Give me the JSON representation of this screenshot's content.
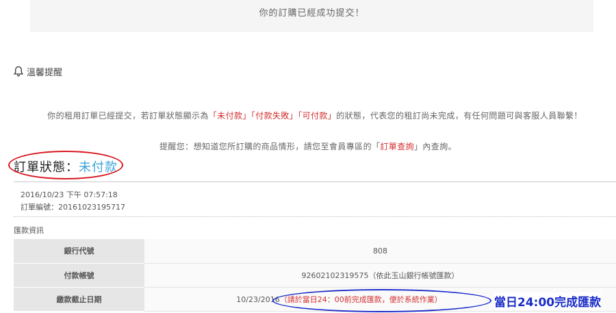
{
  "banner": {
    "message": "你的訂購已經成功提交！"
  },
  "reminder": {
    "title": "溫馨提醒",
    "icon": "bell-icon",
    "line1": {
      "prefix": "你的租用訂單已經提交，若訂單狀態顯示為",
      "status1": "「未付款」",
      "status2": "「付款失敗」",
      "status3": "「可付款」",
      "suffix": "的狀態，代表您的租訂尚未完成，有任何問題可與客服人員聯繫！"
    },
    "line2": {
      "prefix": "提醒您：想知道您所訂購的商品情形，請您至會員專區的「",
      "link": "訂單查詢",
      "suffix": "」內查詢。"
    }
  },
  "order": {
    "status_label": "訂單狀態：",
    "status_value": "未付款",
    "datetime": "2016/10/23 下午 07:57:18",
    "number_label": "訂單編號：",
    "number": "20161023195717"
  },
  "remittance": {
    "section_title": "匯款資訊",
    "rows": [
      {
        "label": "銀行代號",
        "value": "808"
      },
      {
        "label": "付款帳號",
        "value": "92602102319575（依此玉山銀行帳號匯款）"
      },
      {
        "label": "繳款截止日期",
        "value_date": "10/23/2016",
        "value_note": "（請於當日24：00前完成匯款，便於系統作業）"
      }
    ]
  },
  "annotation": {
    "note": "當日24:00完成匯款"
  },
  "colors": {
    "accent_red": "#d32f2f",
    "status_blue": "#3aa3d8",
    "annotation_blue": "#1a2cc8",
    "ellipse_red": "#d9161f"
  }
}
